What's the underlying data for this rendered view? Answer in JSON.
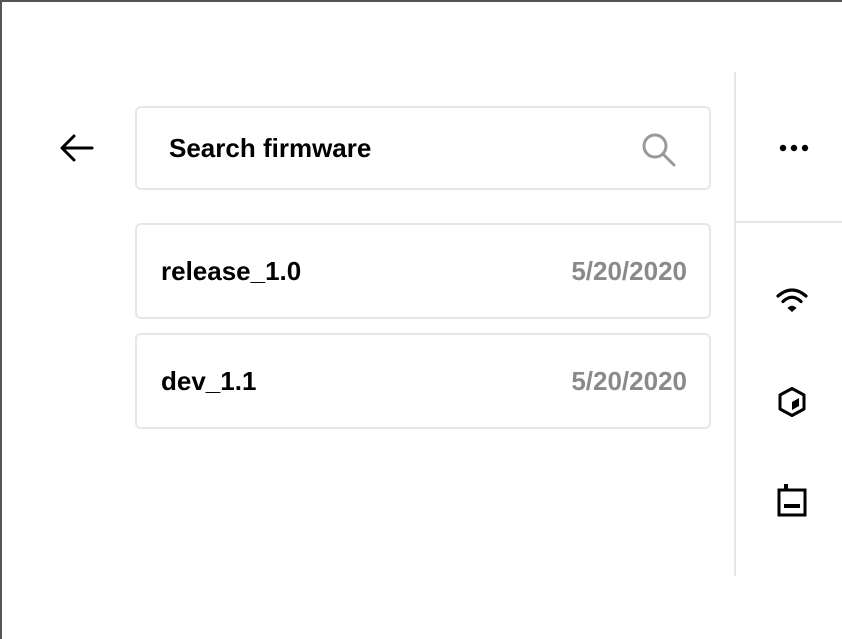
{
  "search": {
    "placeholder": "Search firmware",
    "value": ""
  },
  "firmware_list": [
    {
      "name": "release_1.0",
      "date": "5/20/2020"
    },
    {
      "name": "dev_1.1",
      "date": "5/20/2020"
    }
  ],
  "icons": {
    "back": "arrow-left-icon",
    "search": "search-icon",
    "more": "more-horizontal-icon",
    "wifi": "wifi-icon",
    "cube": "cube-icon",
    "device": "device-icon"
  },
  "colors": {
    "border": "#e7e7e7",
    "text": "#000000",
    "date_text": "#8a8a8a",
    "icon_muted": "#999999"
  }
}
